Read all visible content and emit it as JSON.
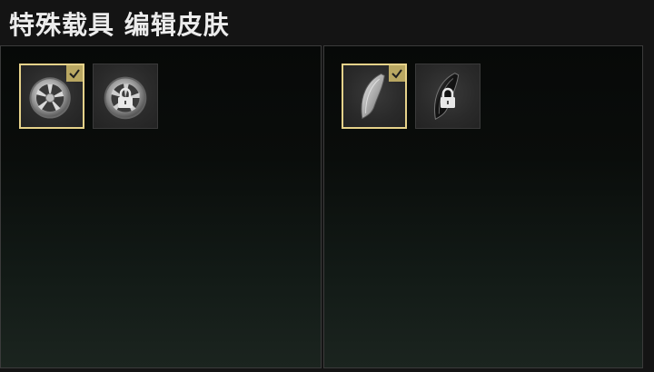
{
  "page": {
    "title": "特殊载具 编辑皮肤"
  },
  "panels": [
    {
      "category": "wheel",
      "items": [
        {
          "icon": "wheel-rim-icon",
          "state": "selected"
        },
        {
          "icon": "wheel-rim-icon",
          "state": "locked"
        }
      ]
    },
    {
      "category": "fender",
      "items": [
        {
          "icon": "fender-icon",
          "state": "selected"
        },
        {
          "icon": "fender-dark-icon",
          "state": "locked"
        }
      ]
    }
  ],
  "colors": {
    "selected_border": "#e6d28a",
    "check_badge": "#b9a762",
    "panel_border": "#3b3b3b",
    "title_text": "#ececec"
  }
}
